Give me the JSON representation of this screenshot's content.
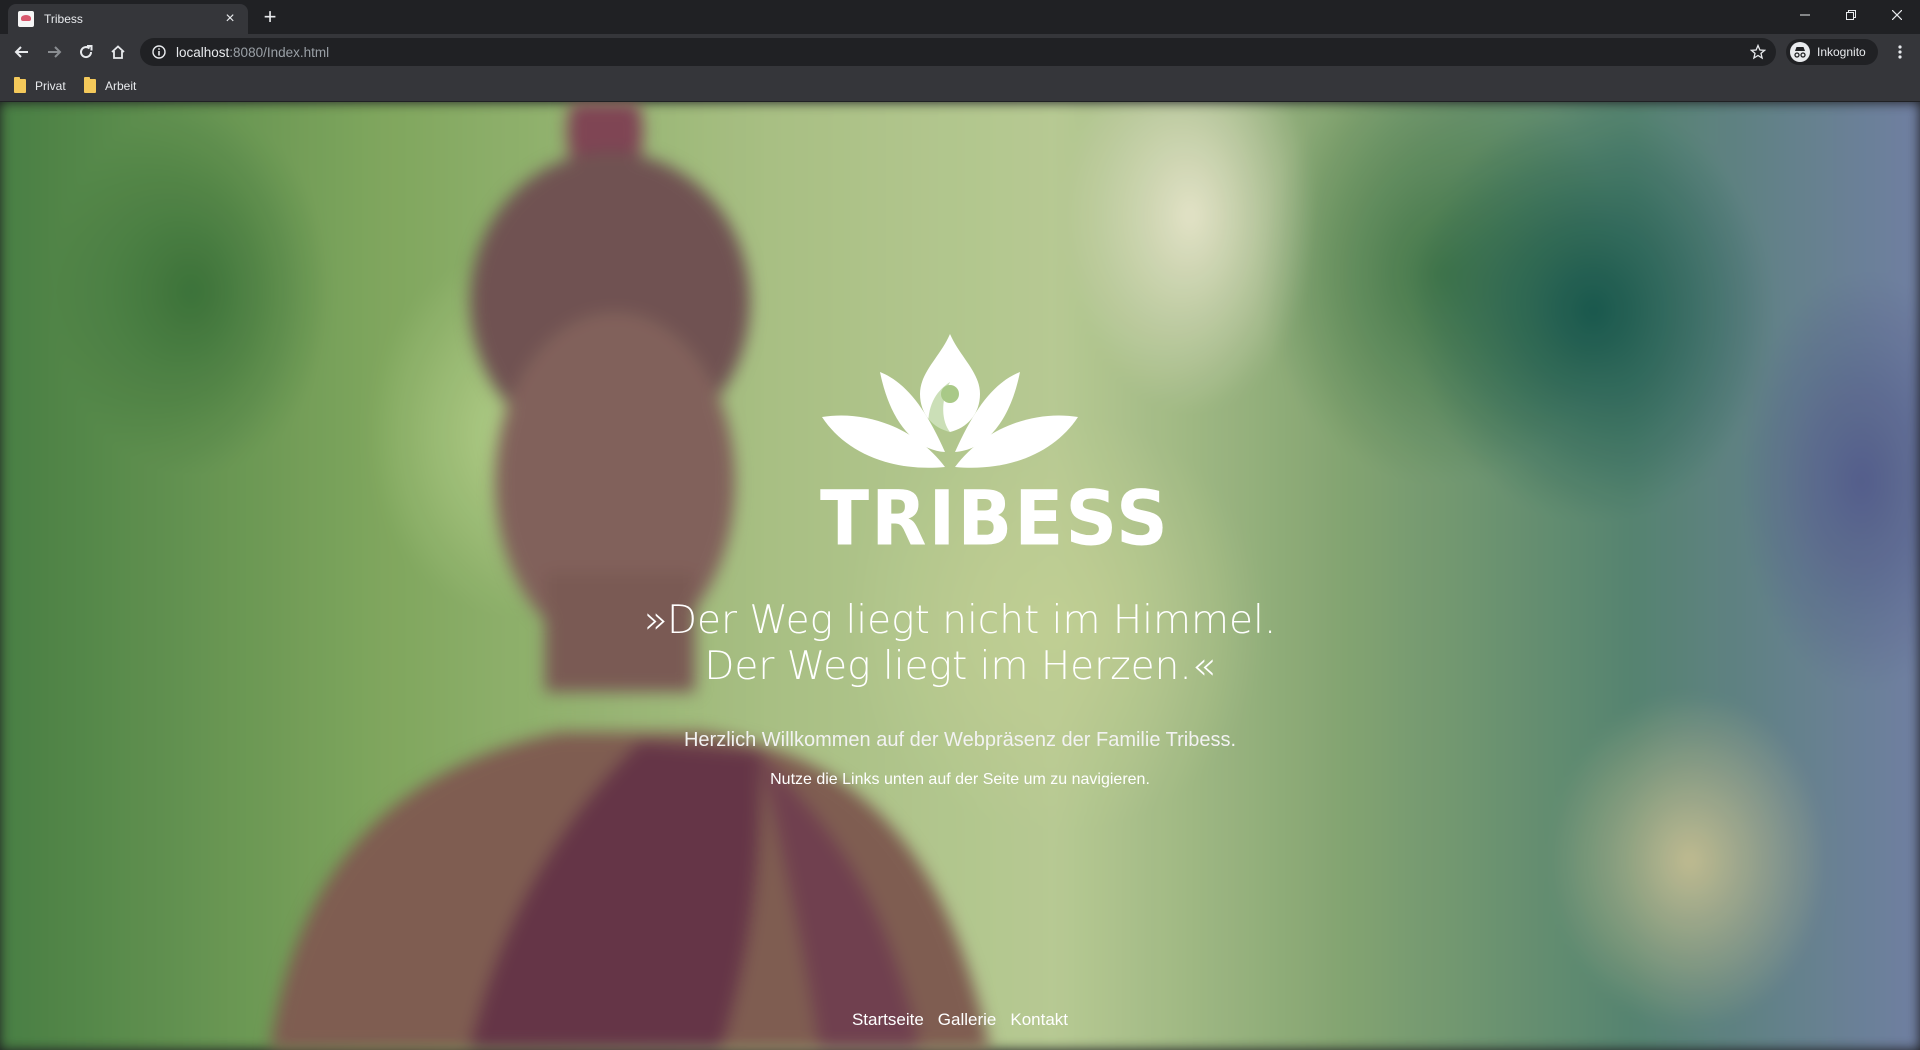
{
  "browser": {
    "tab": {
      "title": "Tribess",
      "close": "×"
    },
    "new_tab": "+",
    "url": {
      "host": "localhost",
      "path": ":8080/Index.html"
    },
    "profile_label": "Inkognito",
    "bookmarks": [
      {
        "label": "Privat"
      },
      {
        "label": "Arbeit"
      }
    ]
  },
  "page": {
    "brand": "TRIBESS",
    "quote_line1": "»Der Weg liegt nicht im Himmel.",
    "quote_line2": "Der Weg liegt im Herzen.«",
    "welcome": "Herzlich Willkommen auf der Webpräsenz der Familie Tribess.",
    "hint": "Nutze die Links unten auf der Seite um zu navigieren.",
    "nav": [
      "Startseite",
      "Gallerie",
      "Kontakt"
    ]
  }
}
